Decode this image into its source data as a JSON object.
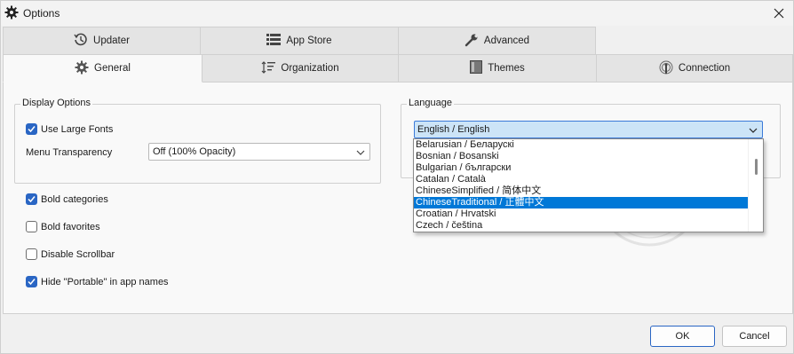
{
  "window": {
    "title": "Options",
    "icon": "gear-icon",
    "close_icon": "close-icon"
  },
  "tabs": {
    "row1": [
      {
        "label": "Updater",
        "icon": "updater-clock-icon"
      },
      {
        "label": "App Store",
        "icon": "app-store-list-icon"
      },
      {
        "label": "Advanced",
        "icon": "wrench-icon"
      }
    ],
    "row2": [
      {
        "label": "General",
        "icon": "gear-icon",
        "active": true
      },
      {
        "label": "Organization",
        "icon": "sort-icon"
      },
      {
        "label": "Themes",
        "icon": "themes-window-icon"
      },
      {
        "label": "Connection",
        "icon": "connection-antenna-icon"
      }
    ]
  },
  "display_options": {
    "legend": "Display Options",
    "use_large_fonts": {
      "label": "Use Large Fonts",
      "checked": true
    },
    "menu_transparency": {
      "label": "Menu Transparency",
      "value": "Off (100% Opacity)"
    }
  },
  "checkboxes": [
    {
      "label": "Bold categories",
      "checked": true
    },
    {
      "label": "Bold favorites",
      "checked": false
    },
    {
      "label": "Disable Scrollbar",
      "checked": false
    },
    {
      "label": "Hide \"Portable\" in app names",
      "checked": true
    }
  ],
  "language": {
    "legend": "Language",
    "selected": "English / English",
    "options": [
      "Belarusian / Беларускі",
      "Bosnian / Bosanski",
      "Bulgarian / български",
      "Catalan / Català",
      "ChineseSimplified / 简体中文",
      "ChineseTraditional / 正體中文",
      "Croatian / Hrvatski",
      "Czech / čeština"
    ],
    "highlighted_index": 5
  },
  "buttons": {
    "ok": "OK",
    "cancel": "Cancel"
  },
  "colors": {
    "accent": "#2a66c4",
    "selection": "#0078d7",
    "combo_focus": "#cce4f7"
  }
}
